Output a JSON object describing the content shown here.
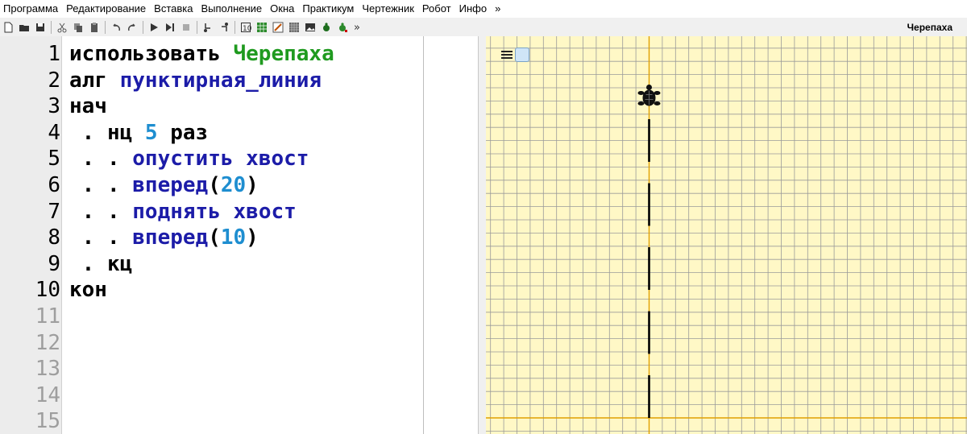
{
  "menu": [
    "Программа",
    "Редактирование",
    "Вставка",
    "Выполнение",
    "Окна",
    "Практикум",
    "Чертежник",
    "Робот",
    "Инфо",
    "»"
  ],
  "toolbar": {
    "icons": [
      "new-file-icon",
      "open-folder-icon",
      "save-icon",
      "cut-icon",
      "copy-icon",
      "paste-icon",
      "undo-icon",
      "redo-icon",
      "run-icon",
      "run-step-icon",
      "stop-icon",
      "step-into-icon",
      "step-out-icon",
      "counter-icon",
      "grid-icon",
      "draw-icon",
      "robot-map-icon",
      "image-icon",
      "turtle-icon",
      "turtle-field-icon"
    ],
    "more": "»"
  },
  "turtle_panel": {
    "title": "Черепаха"
  },
  "editor": {
    "lines": [
      {
        "n": "1",
        "parts": [
          {
            "t": "использовать ",
            "c": "kw"
          },
          {
            "t": "Черепаха",
            "c": "green"
          }
        ]
      },
      {
        "n": "2",
        "parts": [
          {
            "t": "алг ",
            "c": "kw"
          },
          {
            "t": "пунктирная_линия",
            "c": "blue"
          }
        ]
      },
      {
        "n": "3",
        "parts": [
          {
            "t": "нач",
            "c": "kw"
          }
        ]
      },
      {
        "n": "4",
        "parts": [
          {
            "t": " . нц ",
            "c": "kw"
          },
          {
            "t": "5",
            "c": "num"
          },
          {
            "t": " раз",
            "c": "kw"
          }
        ]
      },
      {
        "n": "5",
        "parts": [
          {
            "t": " . . ",
            "c": "kw"
          },
          {
            "t": "опустить хвост",
            "c": "blue"
          }
        ]
      },
      {
        "n": "6",
        "parts": [
          {
            "t": " . . ",
            "c": "kw"
          },
          {
            "t": "вперед",
            "c": "blue"
          },
          {
            "t": "(",
            "c": "plain"
          },
          {
            "t": "20",
            "c": "num"
          },
          {
            "t": ")",
            "c": "plain"
          }
        ]
      },
      {
        "n": "7",
        "parts": [
          {
            "t": " . . ",
            "c": "kw"
          },
          {
            "t": "поднять хвост",
            "c": "blue"
          }
        ]
      },
      {
        "n": "8",
        "parts": [
          {
            "t": " . . ",
            "c": "kw"
          },
          {
            "t": "вперед",
            "c": "blue"
          },
          {
            "t": "(",
            "c": "plain"
          },
          {
            "t": "10",
            "c": "num"
          },
          {
            "t": ")",
            "c": "plain"
          }
        ]
      },
      {
        "n": "9",
        "parts": [
          {
            "t": " . кц",
            "c": "kw"
          }
        ]
      },
      {
        "n": "10",
        "parts": [
          {
            "t": "кон",
            "c": "kw"
          }
        ]
      },
      {
        "n": "11",
        "parts": []
      },
      {
        "n": "12",
        "parts": []
      },
      {
        "n": "13",
        "parts": []
      },
      {
        "n": "14",
        "parts": []
      },
      {
        "n": "15",
        "parts": []
      }
    ]
  },
  "colors": {
    "keyword": "#000000",
    "identifier": "#1c1ca8",
    "module": "#1f9a1f",
    "number": "#1e8ed0",
    "canvas_bg": "#fff8c6",
    "grid": "#9a9a9a",
    "axis": "#e0a000"
  }
}
